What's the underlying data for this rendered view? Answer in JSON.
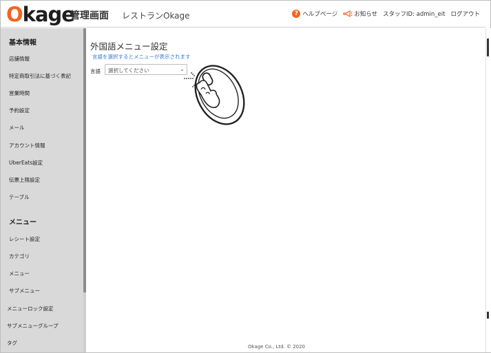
{
  "header": {
    "logo": "Okage",
    "admin_title": "管理画面",
    "restaurant": "レストランOkage",
    "help": "ヘルプページ",
    "news": "お知らせ",
    "staff": "スタッフID: admin_eit",
    "logout": "ログアウト"
  },
  "sidebar": {
    "section1": "基本情報",
    "items1": [
      "店舗情報",
      "特定商取引法に基づく表記",
      "営業時間",
      "予約設定",
      "メール",
      "アカウント情報",
      "UberEats設定",
      "伝票上限設定",
      "テーブル"
    ],
    "section2": "メニュー",
    "items2": [
      "レシート設定",
      "カテゴリ",
      "メニュー",
      "サブメニュー",
      "メニューロック設定",
      "サブメニューグループ",
      "タグ"
    ]
  },
  "main": {
    "title": "外国語メニュー設定",
    "hint": "言語を選択するとメニューが表示されます",
    "lang_label": "言語",
    "select_value": "選択してください"
  },
  "footer": "Okage Co., Ltd. © 2020",
  "colors": {
    "accent": "#f26522",
    "link": "#3a7bd5",
    "sidebar": "#d9d9d9"
  }
}
